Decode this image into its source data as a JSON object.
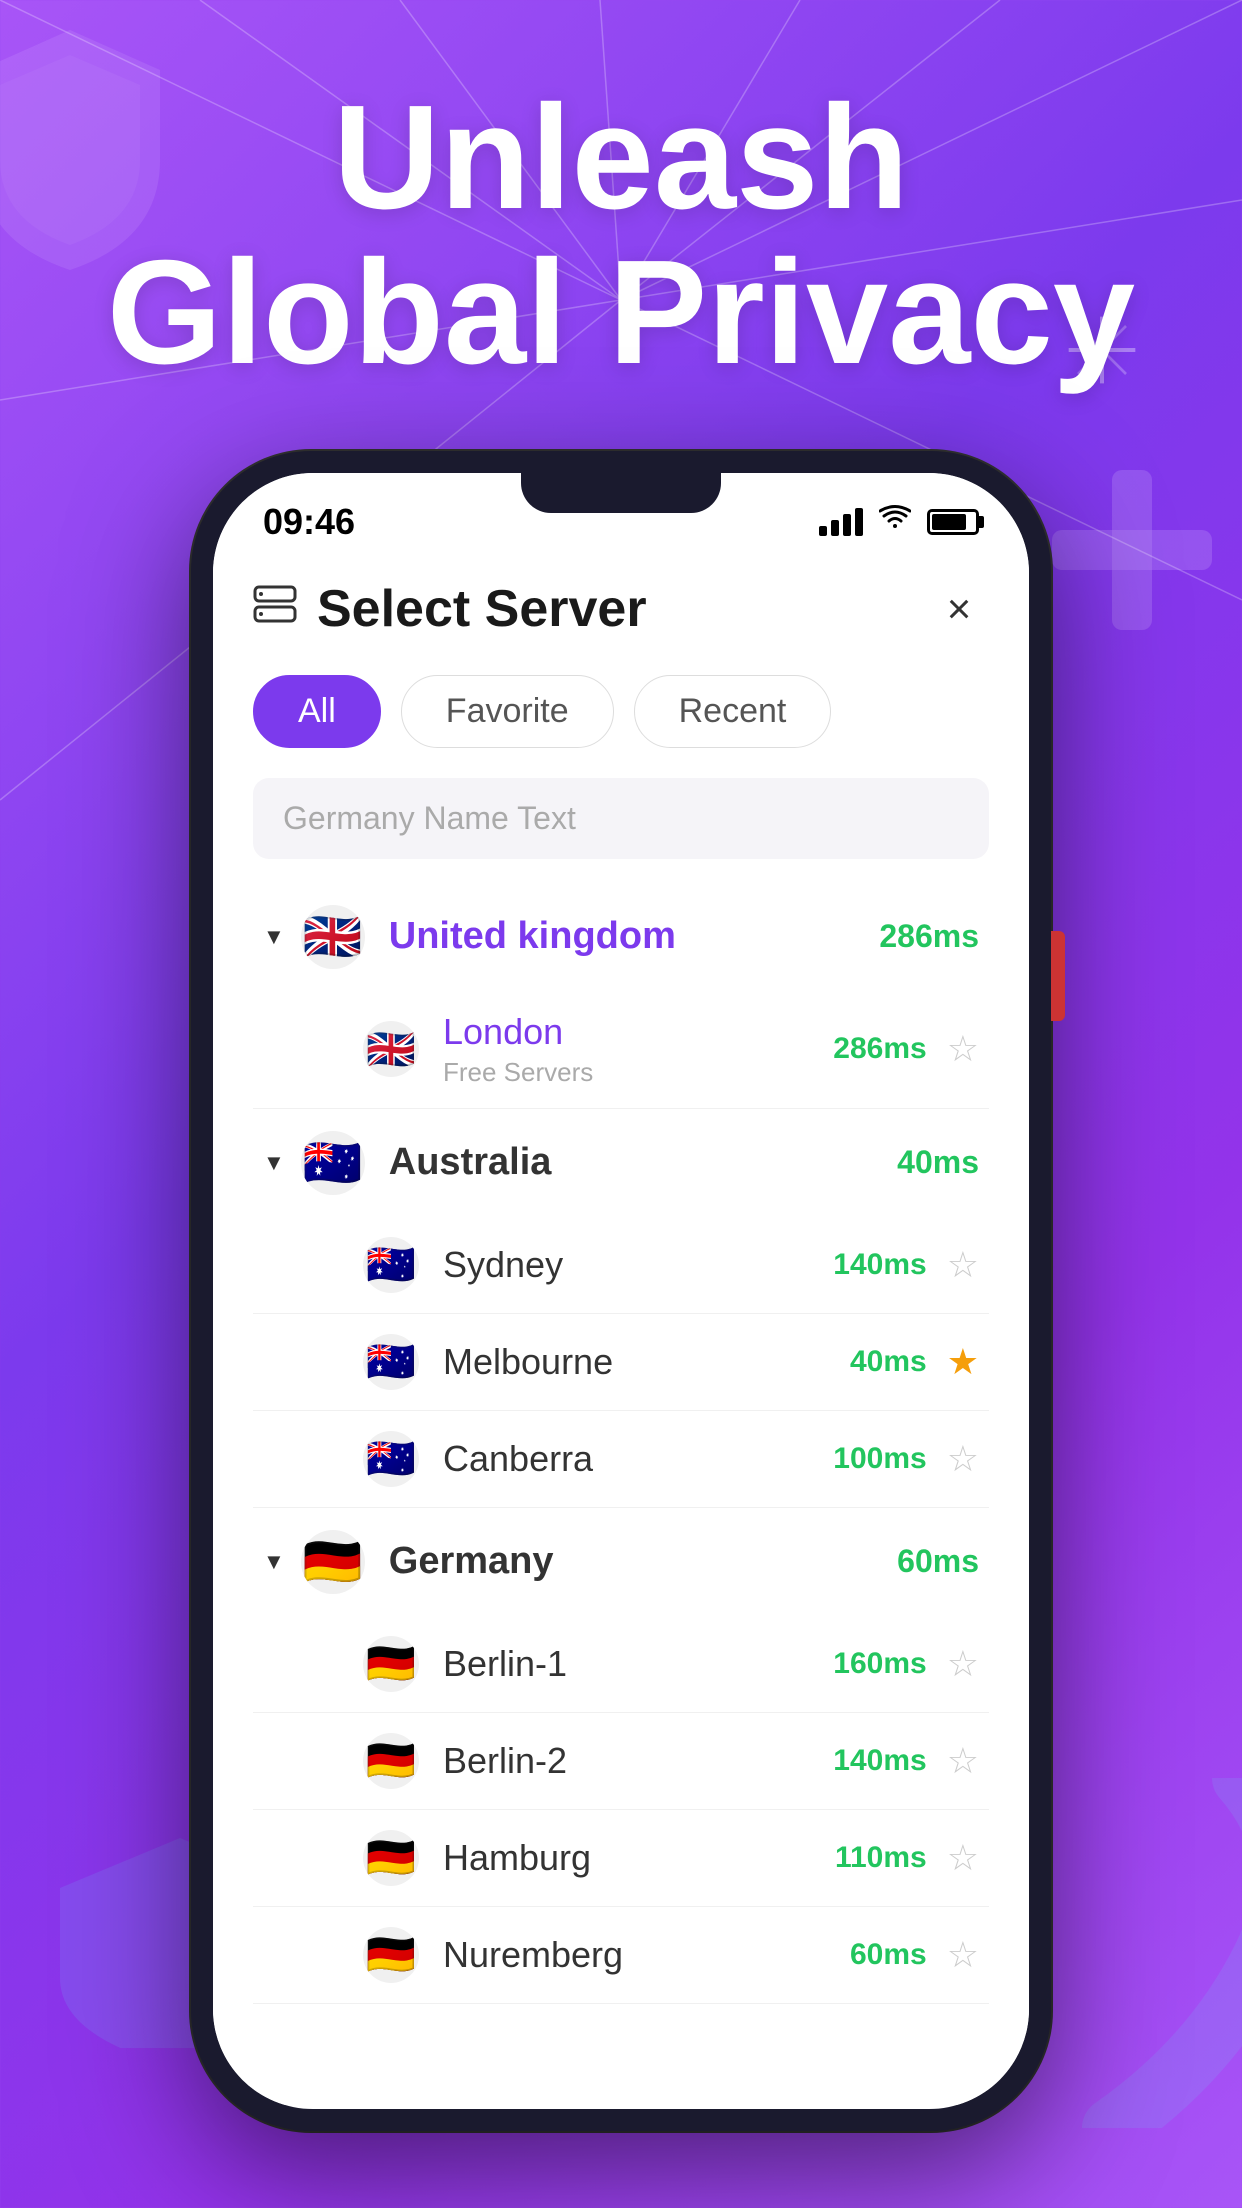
{
  "page": {
    "background_gradient": [
      "#a855f7",
      "#7c3aed"
    ],
    "headline_line1": "Unleash",
    "headline_line2": "Global Privacy"
  },
  "status_bar": {
    "time": "09:46",
    "signal_label": "signal",
    "wifi_label": "wifi",
    "battery_label": "battery"
  },
  "header": {
    "icon_label": "server-icon",
    "title": "Select Server",
    "close_label": "×"
  },
  "tabs": [
    {
      "id": "all",
      "label": "All",
      "active": true
    },
    {
      "id": "favorite",
      "label": "Favorite",
      "active": false
    },
    {
      "id": "recent",
      "label": "Recent",
      "active": false
    }
  ],
  "search": {
    "placeholder": "Germany Name Text"
  },
  "countries": [
    {
      "id": "uk",
      "name": "United kingdom",
      "flag_emoji": "🇬🇧",
      "ping": "286ms",
      "expanded": true,
      "servers": [
        {
          "id": "london",
          "name": "London",
          "subtitle": "Free Servers",
          "flag_emoji": "🇬🇧",
          "ping": "286ms",
          "starred": false
        }
      ]
    },
    {
      "id": "au",
      "name": "Australia",
      "flag_emoji": "🇦🇺",
      "ping": "40ms",
      "expanded": true,
      "servers": [
        {
          "id": "sydney",
          "name": "Sydney",
          "subtitle": "",
          "flag_emoji": "🇦🇺",
          "ping": "140ms",
          "starred": false
        },
        {
          "id": "melbourne",
          "name": "Melbourne",
          "subtitle": "",
          "flag_emoji": "🇦🇺",
          "ping": "40ms",
          "starred": true
        },
        {
          "id": "canberra",
          "name": "Canberra",
          "subtitle": "",
          "flag_emoji": "🇦🇺",
          "ping": "100ms",
          "starred": false
        }
      ]
    },
    {
      "id": "de",
      "name": "Germany",
      "flag_emoji": "🇩🇪",
      "ping": "60ms",
      "expanded": true,
      "servers": [
        {
          "id": "berlin1",
          "name": "Berlin-1",
          "subtitle": "",
          "flag_emoji": "🇩🇪",
          "ping": "160ms",
          "starred": false
        },
        {
          "id": "berlin2",
          "name": "Berlin-2",
          "subtitle": "",
          "flag_emoji": "🇩🇪",
          "ping": "140ms",
          "starred": false
        },
        {
          "id": "hamburg",
          "name": "Hamburg",
          "subtitle": "",
          "flag_emoji": "🇩🇪",
          "ping": "110ms",
          "starred": false
        },
        {
          "id": "nuremberg",
          "name": "Nuremberg",
          "subtitle": "",
          "flag_emoji": "🇩🇪",
          "ping": "60ms",
          "starred": false
        }
      ]
    }
  ]
}
